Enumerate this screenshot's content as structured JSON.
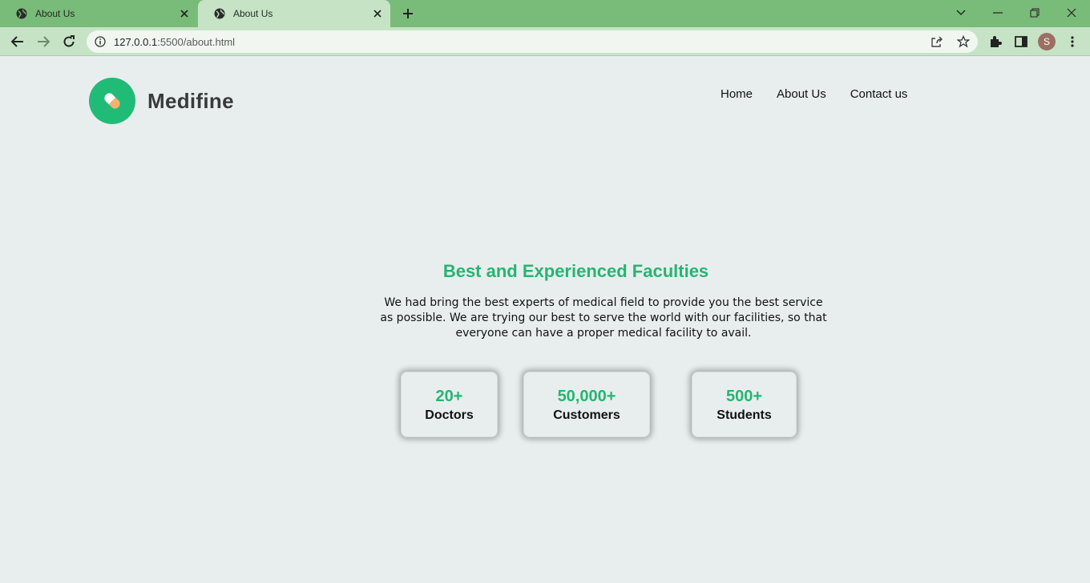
{
  "browser": {
    "tabs": [
      {
        "title": "About Us",
        "active": false
      },
      {
        "title": "About Us",
        "active": true
      }
    ],
    "url_host": "127.0.0.1",
    "url_path": ":5500/about.html",
    "profile_initial": "S",
    "colors": {
      "tabstrip": "#79bb79",
      "toolbar": "#c6e3c6"
    }
  },
  "site": {
    "brand": "Medifine",
    "logo_icon": "pill-icon",
    "nav": [
      "Home",
      "About Us",
      "Contact us"
    ]
  },
  "section": {
    "heading": "Best and Experienced Faculties",
    "description": "We had bring the best experts of medical field to provide you the best service as possible. We are trying our best to serve the world with our facilities, so that everyone can have a proper medical facility to avail."
  },
  "stats": [
    {
      "value": "20+",
      "label": "Doctors"
    },
    {
      "value": "50,000+",
      "label": "Customers"
    },
    {
      "value": "500+",
      "label": "Students"
    }
  ],
  "colors": {
    "accent": "#25b572",
    "logo": "#21bb78",
    "page_bg": "#e8eeee"
  }
}
